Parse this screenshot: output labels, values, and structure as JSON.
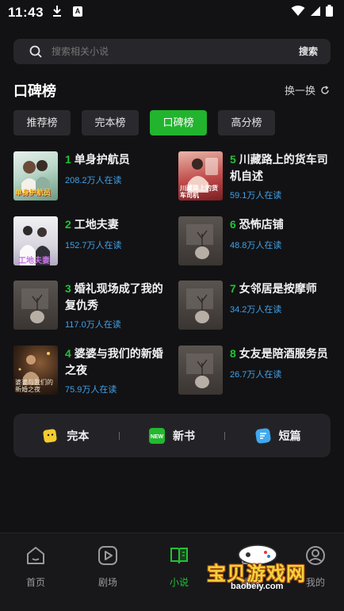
{
  "status": {
    "time": "11:43",
    "notif_a": "A"
  },
  "search": {
    "placeholder": "搜索相关小说",
    "button_label": "搜索"
  },
  "section": {
    "title": "口碑榜",
    "refresh_label": "换一换"
  },
  "tabs": [
    {
      "label": "推荐榜",
      "active": false
    },
    {
      "label": "完本榜",
      "active": false
    },
    {
      "label": "口碑榜",
      "active": true
    },
    {
      "label": "高分榜",
      "active": false
    }
  ],
  "books": [
    {
      "rank": "1",
      "title": "单身护航员",
      "readers": "208.2万人在读",
      "cover_text": "单身护航员"
    },
    {
      "rank": "5",
      "title": "川藏路上的货车司机自述",
      "readers": "59.1万人在读",
      "cover_text": "川藏路上的货车司机"
    },
    {
      "rank": "2",
      "title": "工地夫妻",
      "readers": "152.7万人在读",
      "cover_text": "工地夫妻"
    },
    {
      "rank": "6",
      "title": "恐怖店铺",
      "readers": "48.8万人在读",
      "cover_text": ""
    },
    {
      "rank": "3",
      "title": "婚礼现场成了我的复仇秀",
      "readers": "117.0万人在读",
      "cover_text": ""
    },
    {
      "rank": "7",
      "title": "女邻居是按摩师",
      "readers": "34.2万人在读",
      "cover_text": ""
    },
    {
      "rank": "4",
      "title": "婆婆与我们的新婚之夜",
      "readers": "75.9万人在读",
      "cover_text": "婆婆与我们的新婚之夜"
    },
    {
      "rank": "8",
      "title": "女友是陪酒服务员",
      "readers": "26.7万人在读",
      "cover_text": ""
    }
  ],
  "quick": [
    {
      "label": "完本",
      "icon": "finished-book-icon"
    },
    {
      "label": "新书",
      "icon": "new-book-icon",
      "badge": "NEW"
    },
    {
      "label": "短篇",
      "icon": "short-story-icon"
    }
  ],
  "nav": [
    {
      "label": "首页",
      "icon": "home-icon",
      "active": false
    },
    {
      "label": "剧场",
      "icon": "theater-icon",
      "active": false
    },
    {
      "label": "小说",
      "icon": "novel-icon",
      "active": true
    },
    {
      "label": "福利",
      "icon": "gift-icon",
      "active": false
    },
    {
      "label": "我的",
      "icon": "profile-icon",
      "active": false
    }
  ],
  "watermark": {
    "text": "宝贝游戏网",
    "url": "baobeiy.com"
  },
  "colors": {
    "accent": "#22b42e",
    "readers": "#3fa2e8",
    "background": "#121214"
  }
}
